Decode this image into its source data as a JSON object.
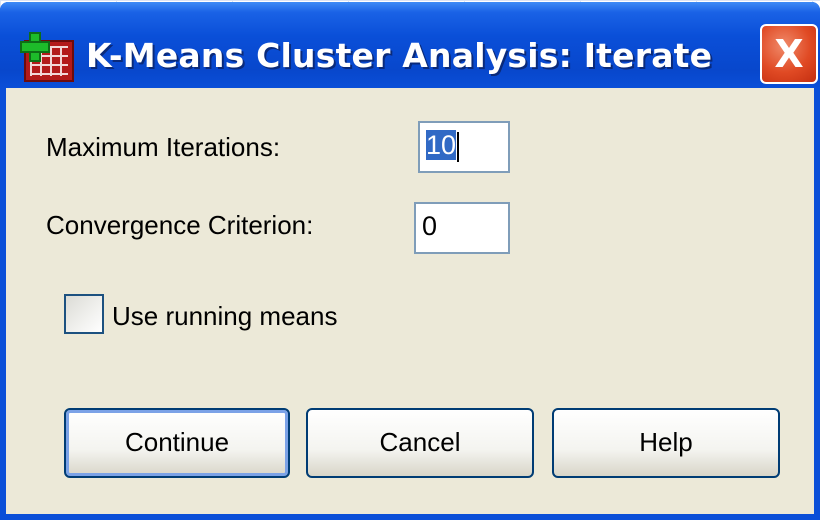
{
  "window": {
    "title": "K-Means Cluster Analysis: Iterate",
    "close_label": "X"
  },
  "form": {
    "max_iterations": {
      "label": "Maximum Iterations:",
      "value": "10"
    },
    "convergence": {
      "label": "Convergence Criterion:",
      "value": "0"
    },
    "running_means": {
      "label": "Use running means",
      "checked": false
    }
  },
  "buttons": {
    "continue": "Continue",
    "cancel": "Cancel",
    "help": "Help"
  },
  "colors": {
    "titlebar": "#0a4fd8",
    "client": "#ece9d8",
    "close": "#e04a24",
    "selection": "#316ac5"
  },
  "icons": {
    "app": "spss-table-plus-icon",
    "close": "close-icon",
    "checkbox": "checkbox-unchecked"
  }
}
